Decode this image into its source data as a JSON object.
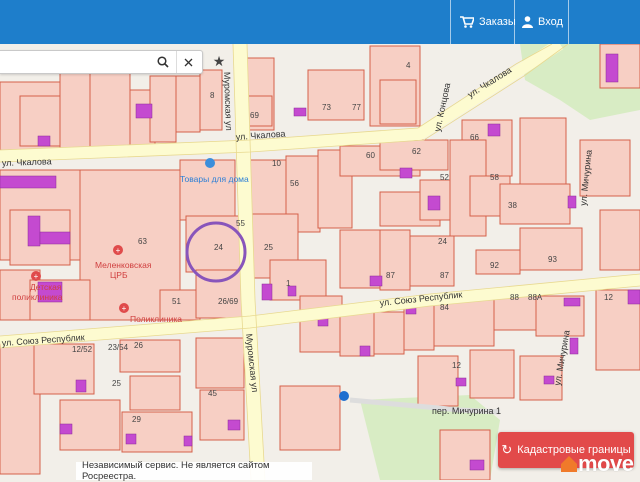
{
  "header": {
    "orders_label": "Заказы",
    "login_label": "Вход",
    "bg_color": "#1e7ecb"
  },
  "search": {
    "value": "",
    "placeholder": ""
  },
  "map": {
    "streets": {
      "chkalova_left": "ул. Чкалова",
      "chkalova_mid": "ул. Чкалова",
      "chkalova_right": "ул. Чкалова",
      "kontsova": "ул. Концова",
      "michurina": "ул. Мичурина",
      "soyuz_resp_left": "ул. Союз Республик",
      "soyuz_resp_mid": "ул. Союз Республик",
      "muromskaya": "Муромская ул",
      "muromskaya_top": "Муромская ул",
      "per_michurina": "пер. Мичурина 1"
    },
    "pois": {
      "goods": "Товары для дома",
      "hospital_line1": "Меленковская",
      "hospital_line2": "ЦРБ",
      "clinic_line1": "Детская",
      "clinic_line2": "поликлиника",
      "clinic2": "Поликлиника"
    },
    "house_numbers": [
      "24",
      "8",
      "4",
      "77",
      "73",
      "69",
      "10",
      "62",
      "60",
      "56",
      "63",
      "66",
      "58",
      "52",
      "55",
      "24",
      "25",
      "87",
      "87",
      "92",
      "93",
      "88",
      "88А",
      "84",
      "12",
      "26/69",
      "51",
      "12/52",
      "23/54",
      "25",
      "26",
      "29",
      "45",
      "1",
      "12",
      "38"
    ],
    "colors": {
      "parcel_fill": "#f7cfc4",
      "parcel_border": "#d4604a",
      "highlight": "#c44ad0",
      "street": "#fdfbd0",
      "circle": "#8855bb"
    }
  },
  "footer": {
    "disclaimer": "Независимый сервис. Не является сайтом Росреестра."
  },
  "cadastre_button": {
    "label": "Кадастровые границы"
  },
  "logo": {
    "text": "move"
  }
}
